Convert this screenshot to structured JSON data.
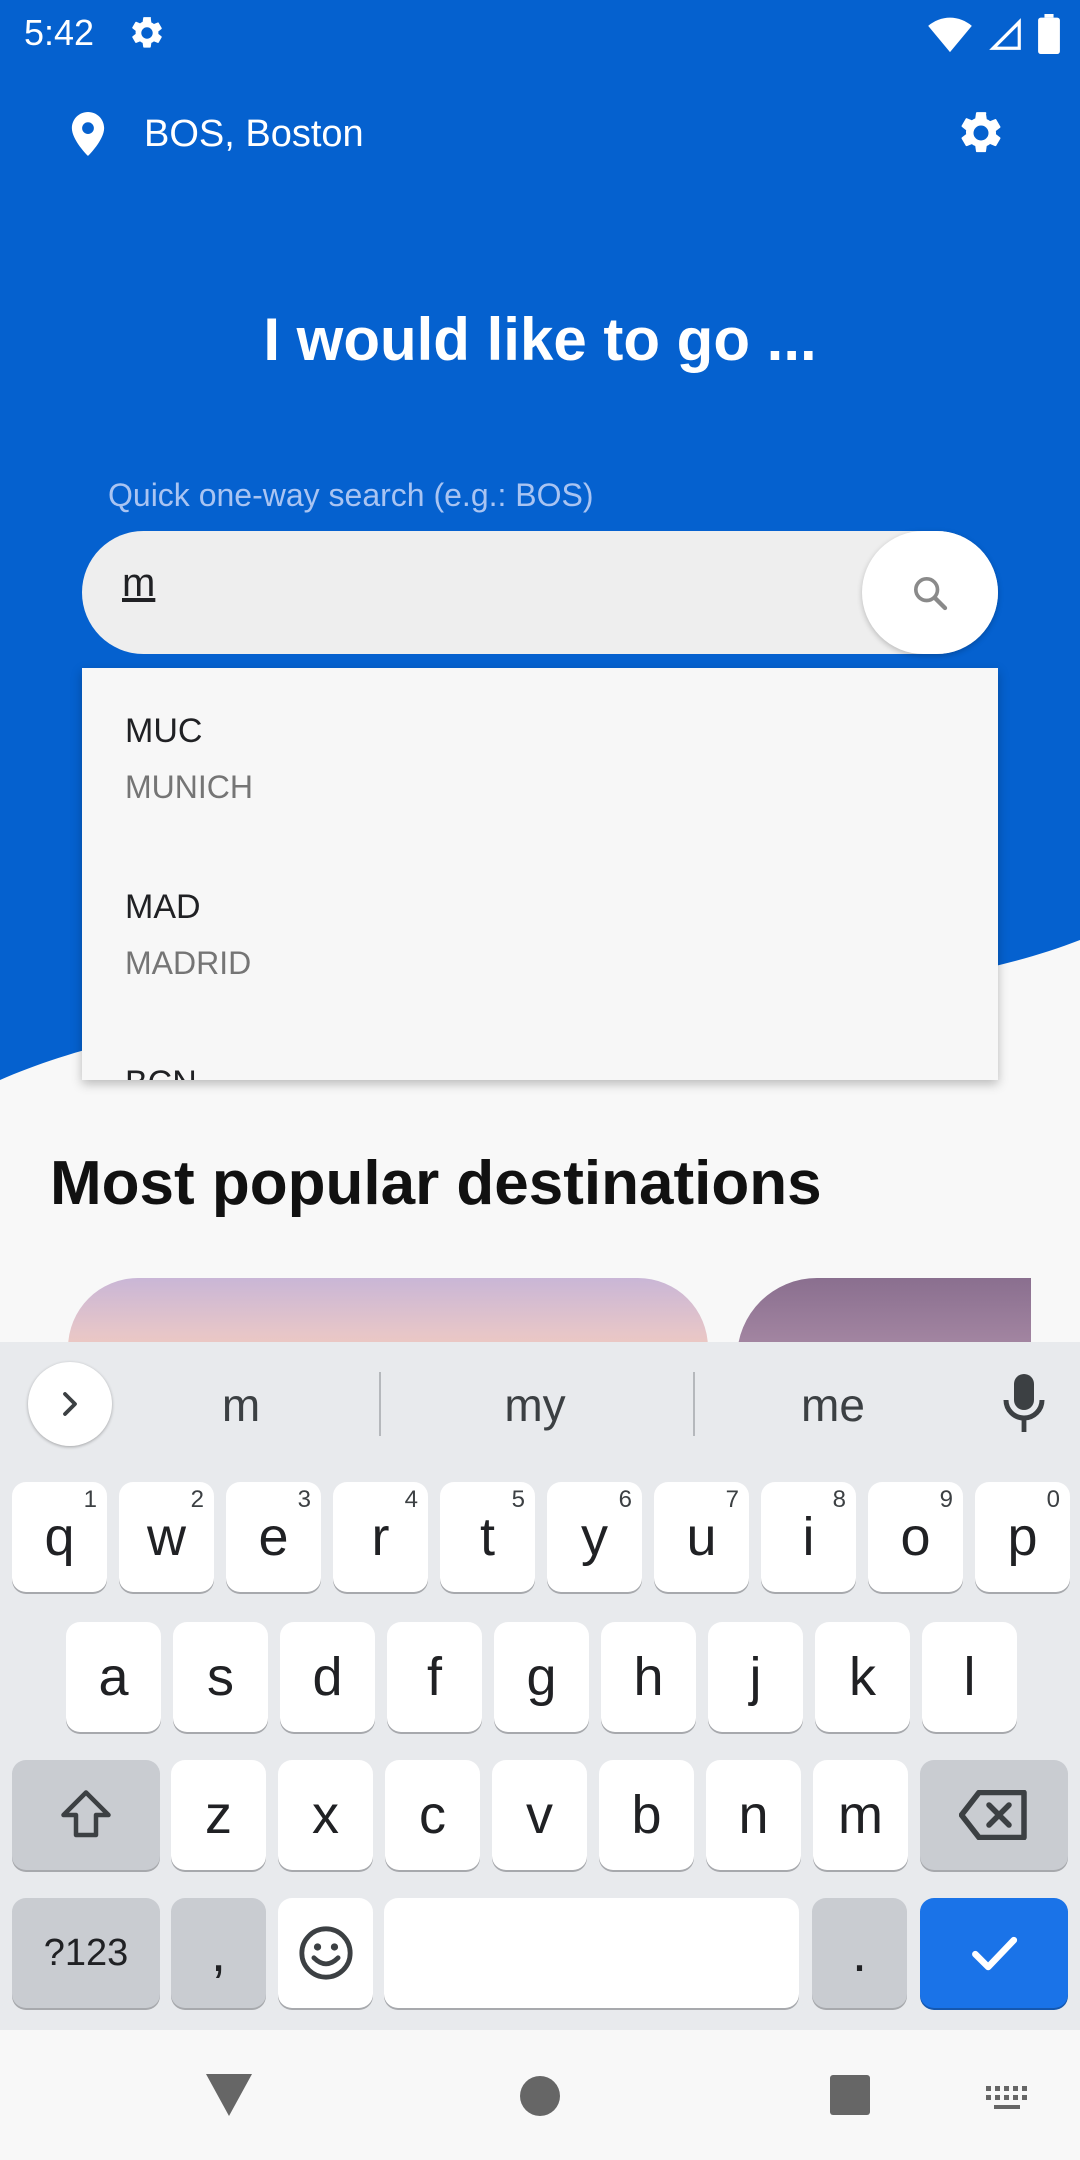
{
  "status_bar": {
    "time": "5:42"
  },
  "header": {
    "location": "BOS, Boston"
  },
  "headline": "I would like to go ...",
  "search": {
    "label": "Quick one-way search (e.g.: BOS)",
    "value": "m"
  },
  "dropdown": {
    "items": [
      {
        "code": "MUC",
        "city": "MUNICH"
      },
      {
        "code": "MAD",
        "city": "MADRID"
      },
      {
        "code": "BCN",
        "city": ""
      }
    ]
  },
  "section_title": "Most popular destinations",
  "keyboard": {
    "suggestions": [
      "m",
      "my",
      "me"
    ],
    "row1": [
      {
        "k": "q",
        "h": "1"
      },
      {
        "k": "w",
        "h": "2"
      },
      {
        "k": "e",
        "h": "3"
      },
      {
        "k": "r",
        "h": "4"
      },
      {
        "k": "t",
        "h": "5"
      },
      {
        "k": "y",
        "h": "6"
      },
      {
        "k": "u",
        "h": "7"
      },
      {
        "k": "i",
        "h": "8"
      },
      {
        "k": "o",
        "h": "9"
      },
      {
        "k": "p",
        "h": "0"
      }
    ],
    "row2": [
      "a",
      "s",
      "d",
      "f",
      "g",
      "h",
      "j",
      "k",
      "l"
    ],
    "row3": [
      "z",
      "x",
      "c",
      "v",
      "b",
      "n",
      "m"
    ],
    "symbols_label": "?123",
    "comma_label": ",",
    "period_label": "."
  },
  "colors": {
    "brand_blue": "#0561cf",
    "accent_blue": "#1a73e8"
  }
}
